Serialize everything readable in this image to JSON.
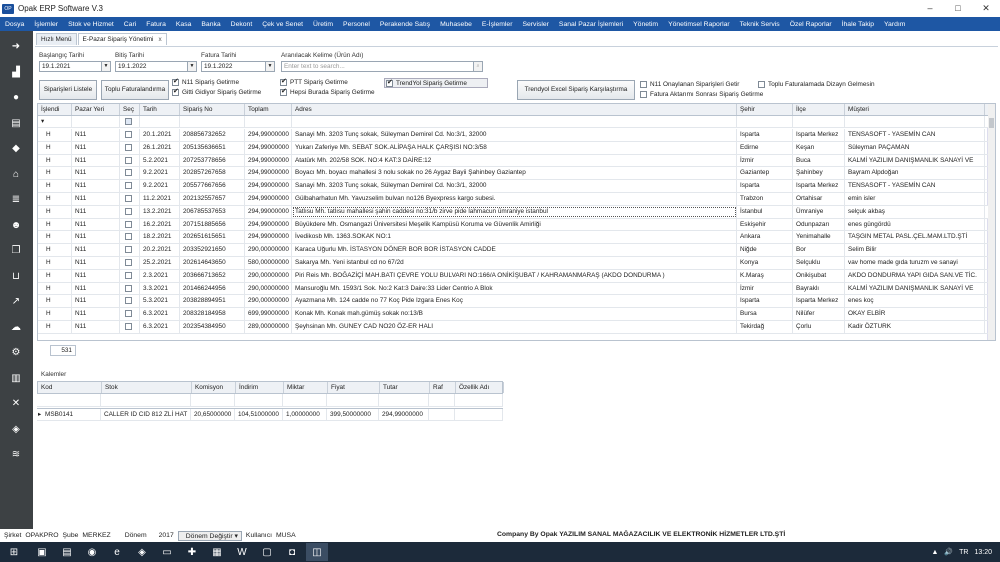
{
  "window": {
    "title": "Opak ERP Software V.3",
    "logo": "OP",
    "minimize": "–",
    "maximize": "□",
    "close": "✕"
  },
  "menu": [
    "Dosya",
    "İşlemler",
    "Stok ve Hizmet",
    "Cari",
    "Fatura",
    "Kasa",
    "Banka",
    "Dekont",
    "Çek ve Senet",
    "Üretim",
    "Personel",
    "Perakende Satış",
    "Muhasebe",
    "E-İşlemler",
    "Servisler",
    "Sanal Pazar İşlemleri",
    "Yönetim",
    "Yönetimsel Raporlar",
    "Teknik Servis",
    "Özel Raporlar",
    "İhale Takip",
    "Yardım"
  ],
  "sidebar_icons": [
    "arrow-right-icon",
    "factory-icon",
    "user-icon",
    "documents-icon",
    "money-icon",
    "home-icon",
    "list-icon",
    "people-icon",
    "copy-icon",
    "cart-icon",
    "chart-icon",
    "cloud-icon",
    "gear-icon",
    "files-icon",
    "tools-icon",
    "layers-icon",
    "stack-icon"
  ],
  "tabs": [
    {
      "label": "Hızlı Menü"
    },
    {
      "label": "E-Pazar Sipariş Yönetimi",
      "close": "x"
    }
  ],
  "filters": {
    "start_label": "Başlangıç Tarihi",
    "start_value": "19.1.2021",
    "end_label": "Bitiş Tarihi",
    "end_value": "19.1.2022",
    "invoice_label": "Fatura Tarihi",
    "invoice_value": "19.1.2022",
    "search_label": "Aranılacak Kelime (Ürün Adı)",
    "search_placeholder": "Enter text to search..."
  },
  "buttons": {
    "list_orders": "Siparişleri Listele",
    "bulk_invoice": "Toplu Faturalandırma",
    "trendyol_excel": "Trendyol Excel Sipariş Karşılaştırma"
  },
  "checkboxes": {
    "n11": "N11 Sipariş Getirme",
    "gitti": "Gitti Gidiyor Sipariş Getirme",
    "ptt": "PTT Sipariş Getirme",
    "hepsiburada": "Hepsi Burada Sipariş Getirme",
    "trendyol": "TrendYol Sipariş Getirme",
    "n11_approved": "N11 Onaylanan Siparişleri Getir",
    "after_transfer": "Fatura Aktarımı Sonrası Sipariş Getirme",
    "bulk_layout": "Toplu Faturalamada Dizayn Gelmesin"
  },
  "orders": {
    "columns": [
      "İşlendi",
      "Pazar Yeri",
      "Seç",
      "Tarih",
      "Sipariş No",
      "Toplam",
      "Adres",
      "Şehir",
      "İlçe",
      "Müşteri"
    ],
    "rows": [
      {
        "processed": "H",
        "market": "N11",
        "date": "20.1.2021",
        "order": "208856732652",
        "total": "294,99000000",
        "address": "Sanayi Mh.  3203 Tunç sokak, Süleyman Demirel Cd. No:3/1, 32000",
        "city": "Isparta",
        "district": "Isparta Merkez",
        "customer": "TENSASOFT - YASEMİN CAN"
      },
      {
        "processed": "H",
        "market": "N11",
        "date": "26.1.2021",
        "order": "205135636651",
        "total": "294,99000000",
        "address": "Yukarı Zaferiye Mh.  SEBAT SOK.ALİPAŞA HALK ÇARŞISI NO:3/58",
        "city": "Edirne",
        "district": "Keşan",
        "customer": "Süleyman PAÇAMAN"
      },
      {
        "processed": "H",
        "market": "N11",
        "date": "5.2.2021",
        "order": "207253778656",
        "total": "294,99000000",
        "address": "Atatürk Mh.  202/58 SOK. NO:4 KAT:3 DAİRE:12",
        "city": "İzmir",
        "district": "Buca",
        "customer": "KALMİ YAZILIM DANIŞMANLIK SANAYİ VE"
      },
      {
        "processed": "H",
        "market": "N11",
        "date": "9.2.2021",
        "order": "202857267658",
        "total": "294,99000000",
        "address": "Boyacı Mh.  boyacı mahallesi 3 nolu sokak no 26 Aygaz Bayii Şahinbey Gaziantep",
        "city": "Gaziantep",
        "district": "Şahinbey",
        "customer": "Bayram Alpdoğan"
      },
      {
        "processed": "H",
        "market": "N11",
        "date": "9.2.2021",
        "order": "205577667656",
        "total": "294,99000000",
        "address": "Sanayi Mh.  3203 Tunç sokak, Süleyman Demirel Cd. No:3/1, 32000",
        "city": "Isparta",
        "district": "Isparta Merkez",
        "customer": "TENSASOFT - YASEMİN CAN"
      },
      {
        "processed": "H",
        "market": "N11",
        "date": "11.2.2021",
        "order": "202132557657",
        "total": "294,99000000",
        "address": "Gülbaharhatun Mh.  Yavuzselim bulvarı no126 Byexpress kargo subesi.",
        "city": "Trabzon",
        "district": "Ortahisar",
        "customer": "emin isler"
      },
      {
        "processed": "H",
        "market": "N11",
        "date": "13.2.2021",
        "order": "206785537653",
        "total": "294,99000000",
        "address": "Tatlısu Mh.  tatlısu mahallesi şahin caddesi no:31/b zirve pide lahmacun ümraniye istanbul",
        "city": "İstanbul",
        "district": "Ümraniye",
        "customer": "selçuk akbaş"
      },
      {
        "processed": "H",
        "market": "N11",
        "date": "16.2.2021",
        "order": "207151885656",
        "total": "294,99000000",
        "address": "Büyükdere Mh.  Osmangazi Üniversitesi Meşelik Kampüsü Koruma ve Güvenlik Amirliği",
        "city": "Eskişehir",
        "district": "Odunpazarı",
        "customer": "enes güngördü"
      },
      {
        "processed": "H",
        "market": "N11",
        "date": "18.2.2021",
        "order": "202651615651",
        "total": "294,99000000",
        "address": "İvedikosb Mh.  1363.SOKAK NO:1",
        "city": "Ankara",
        "district": "Yenimahalle",
        "customer": "TAŞGIN METAL PASL.ÇEL.MAM.LTD.ŞTİ"
      },
      {
        "processed": "H",
        "market": "N11",
        "date": "20.2.2021",
        "order": "203352921650",
        "total": "290,00000000",
        "address": "Karaca Uğurlu Mh.  İSTASYON DÖNER BOR BOR İSTASYON CADDE",
        "city": "Niğde",
        "district": "Bor",
        "customer": "Selim Bilir"
      },
      {
        "processed": "H",
        "market": "N11",
        "date": "25.2.2021",
        "order": "202614643650",
        "total": "580,00000000",
        "address": "Sakarya Mh.  Yeni istanbul cd no 67/2d",
        "city": "Konya",
        "district": "Selçuklu",
        "customer": "vav home made gıda turuzm ve sanayi"
      },
      {
        "processed": "H",
        "market": "N11",
        "date": "2.3.2021",
        "order": "203666713652",
        "total": "290,00000000",
        "address": "Piri Reis Mh.  BOĞAZİÇİ MAH.BATI ÇEVRE YOLU BULVARI NO:166/A ONİKİŞUBAT / KAHRAMANMARAŞ (AKDO DONDURMA )",
        "city": "K.Maraş",
        "district": "Onikişubat",
        "customer": "AKDO DONDURMA YAPI GIDA SAN.VE TİC."
      },
      {
        "processed": "H",
        "market": "N11",
        "date": "3.3.2021",
        "order": "201466244956",
        "total": "290,00000000",
        "address": "Mansuroğlu Mh.  1593/1 Sok. No:2 Kat:3 Daire:33 Lider Centrio A Blok",
        "city": "İzmir",
        "district": "Bayraklı",
        "customer": "KALMİ YAZILIM DANIŞMANLIK SANAYİ VE"
      },
      {
        "processed": "H",
        "market": "N11",
        "date": "5.3.2021",
        "order": "203828894951",
        "total": "290,00000000",
        "address": "Ayazmana Mh.  124 cadde no 77 Koç Pide Izgara Enes Koç",
        "city": "Isparta",
        "district": "Isparta Merkez",
        "customer": "enes koç"
      },
      {
        "processed": "H",
        "market": "N11",
        "date": "6.3.2021",
        "order": "208328184958",
        "total": "699,99000000",
        "address": "Konak Mh.  Konak mah.gümüş sokak no:13/B",
        "city": "Bursa",
        "district": "Nilüfer",
        "customer": "OKAY ELBİR"
      },
      {
        "processed": "H",
        "market": "N11",
        "date": "6.3.2021",
        "order": "202354384950",
        "total": "289,00000000",
        "address": "Şeyhsinan Mh.  GUNEY CAD NO20 ÖZ-ER HALI",
        "city": "Tekirdağ",
        "district": "Çorlu",
        "customer": "Kadir ÖZTURK"
      }
    ],
    "count": "531"
  },
  "items": {
    "section_label": "Kalemler",
    "columns": [
      "Kod",
      "Stok",
      "Komisyon",
      "İndirim",
      "Miktar",
      "Fiyat",
      "Tutar",
      "Raf",
      "Özellik Adı"
    ],
    "rows": [
      {
        "code": "MSB0141",
        "stock": "CALLER ID CID 812 ZLİ HAT",
        "commission": "20,65000000",
        "discount": "104,51000000",
        "qty": "1,00000000",
        "price": "399,50000000",
        "amount": "294,99000000",
        "shelf": "",
        "feature": ""
      }
    ]
  },
  "status": {
    "company_label": "Şirket",
    "company": "OPAKPRO",
    "branch_label": "Şube",
    "branch": "MERKEZ",
    "period_label": "Dönem",
    "period": "2017",
    "period_change": "Dönem Değiştir",
    "user_label": "Kullanıcı",
    "user": "MUSA",
    "footer": "Company By Opak YAZILIM SANAL MAĞAZACILIK VE ELEKTRONİK HİZMETLER LTD.ŞTİ"
  },
  "taskbar": {
    "time": "13:20",
    "tray_up": "▲",
    "volume": "🔊",
    "language": "TR"
  }
}
